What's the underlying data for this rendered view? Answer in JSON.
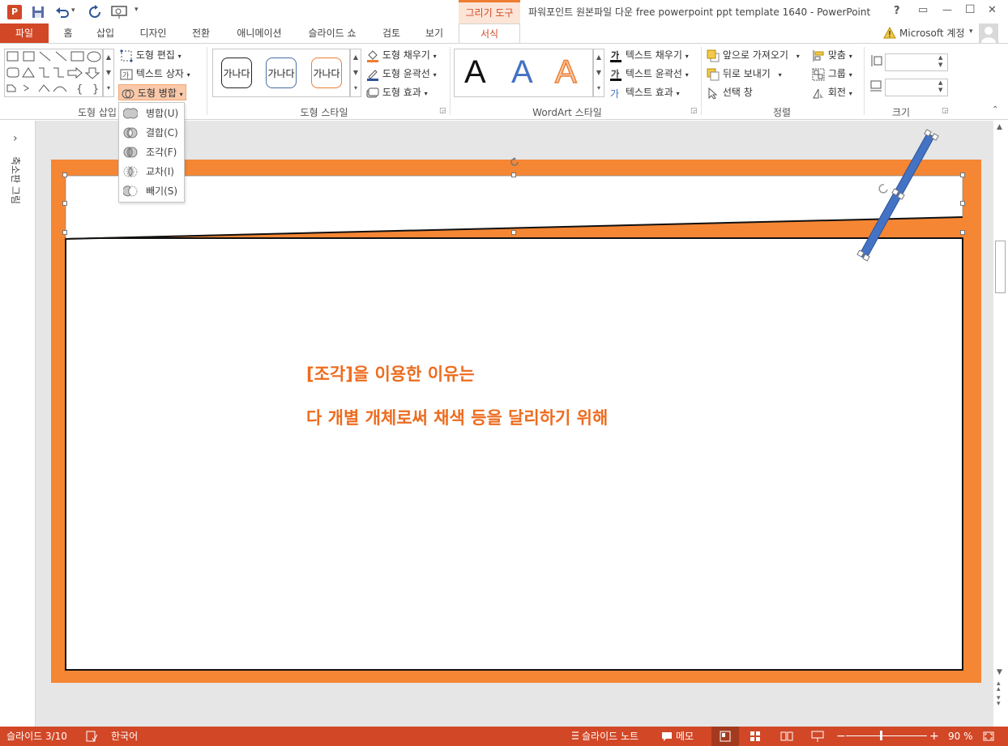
{
  "window": {
    "title": "파워포인트 원본파일 다운 free powerpoint ppt template 1640 - PowerPoint",
    "context_tab_group": "그리기 도구",
    "controls": {
      "help": "?",
      "restore_ribbon": "▭",
      "minimize": "—",
      "maximize": "☐",
      "close": "✕"
    }
  },
  "tabs": [
    {
      "label": "파일"
    },
    {
      "label": "홈"
    },
    {
      "label": "삽입"
    },
    {
      "label": "디자인"
    },
    {
      "label": "전환"
    },
    {
      "label": "애니메이션"
    },
    {
      "label": "슬라이드 쇼"
    },
    {
      "label": "검토"
    },
    {
      "label": "보기"
    },
    {
      "label": "서식"
    }
  ],
  "account": {
    "label": "Microsoft 계정",
    "warning_icon": "warning-icon"
  },
  "ribbon": {
    "insert_shapes": {
      "label": "도형 삽입",
      "edit_shape": "도형 편집",
      "text_box": "텍스트 상자",
      "merge_shapes": "도형 병합"
    },
    "shape_styles": {
      "label": "도형 스타일",
      "samples": [
        "가나다",
        "가나다",
        "가나다"
      ],
      "fill": "도형 채우기",
      "outline": "도형 윤곽선",
      "effects": "도형 효과"
    },
    "wordart": {
      "label": "WordArt 스타일",
      "samples": [
        "A",
        "A",
        "A"
      ],
      "text_fill": "텍스트 채우기",
      "text_outline": "텍스트 윤곽선",
      "text_effects": "텍스트 효과"
    },
    "arrange": {
      "label": "정렬",
      "bring_forward": "앞으로 가져오기",
      "send_backward": "뒤로 보내기",
      "selection_pane": "선택 창",
      "align": "맞춤",
      "group": "그룹",
      "rotate": "회전"
    },
    "size": {
      "label": "크기",
      "height": "",
      "width": ""
    }
  },
  "merge_menu": [
    {
      "label": "병합(U)"
    },
    {
      "label": "결합(C)"
    },
    {
      "label": "조각(F)"
    },
    {
      "label": "교차(I)"
    },
    {
      "label": "빼기(S)"
    }
  ],
  "thumbnail_pane": {
    "label": "축소판 그림",
    "expand": "›"
  },
  "slide": {
    "line1": "[조각]을 이용한 이유는",
    "line2": "다 개별 개체로써 채색 등을 달리하기 위해",
    "frame_color": "#f58634",
    "text_color": "#ed6c1f",
    "bar_color": "#4472c4"
  },
  "status": {
    "slide_info": "슬라이드 3/10",
    "language": "한국어",
    "notes": "슬라이드 노트",
    "comments": "메모",
    "zoom": "90 %"
  },
  "colors": {
    "accent": "#d24726",
    "context": "#ed7d31"
  }
}
